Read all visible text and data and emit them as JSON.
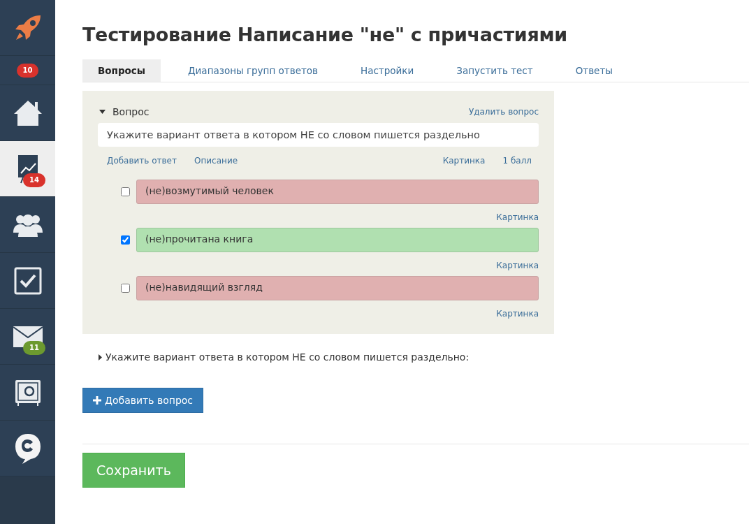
{
  "sidebar": {
    "items": [
      {
        "kind": "icon",
        "selected": false
      },
      {
        "kind": "badge",
        "badge": "10",
        "color": "#d9322c"
      },
      {
        "kind": "icon",
        "selected": false
      },
      {
        "kind": "icon",
        "selected": true,
        "badge": "14",
        "color": "#d9322c"
      },
      {
        "kind": "icon",
        "selected": false
      },
      {
        "kind": "icon",
        "selected": false
      },
      {
        "kind": "icon",
        "selected": false,
        "badge": "11",
        "color": "#6c9a2f"
      },
      {
        "kind": "icon",
        "selected": false
      },
      {
        "kind": "icon",
        "selected": false
      }
    ]
  },
  "title": "Тестирование Написание \"не\" с причастиями",
  "tabs": [
    {
      "label": "Вопросы",
      "selected": true
    },
    {
      "label": "Диапазоны групп ответов",
      "selected": false
    },
    {
      "label": "Настройки",
      "selected": false
    },
    {
      "label": "Запустить тест",
      "selected": false
    },
    {
      "label": "Ответы",
      "selected": false
    }
  ],
  "question": {
    "expanded": true,
    "label": "Вопрос",
    "delete": "Удалить вопрос",
    "text": "Укажите вариант ответа в котором НЕ со словом пишется раздельно",
    "links": [
      "Добавить ответ",
      "Описание"
    ],
    "picture": "Картинка",
    "points": "1 балл",
    "answers": [
      {
        "text": "(не)возмутимый человек",
        "checked": false,
        "picture": "Картинка"
      },
      {
        "text": "(не)прочитана книга",
        "checked": true,
        "picture": "Картинка"
      },
      {
        "text": "(не)навидящий взгляд",
        "checked": false,
        "picture": "Картинка"
      }
    ]
  },
  "collapsed_question": {
    "expanded": false,
    "text": "Укажите вариант ответа в котором НЕ со словом пишется раздельно:"
  },
  "add_question": "Добавить вопрос",
  "save": "Сохранить"
}
